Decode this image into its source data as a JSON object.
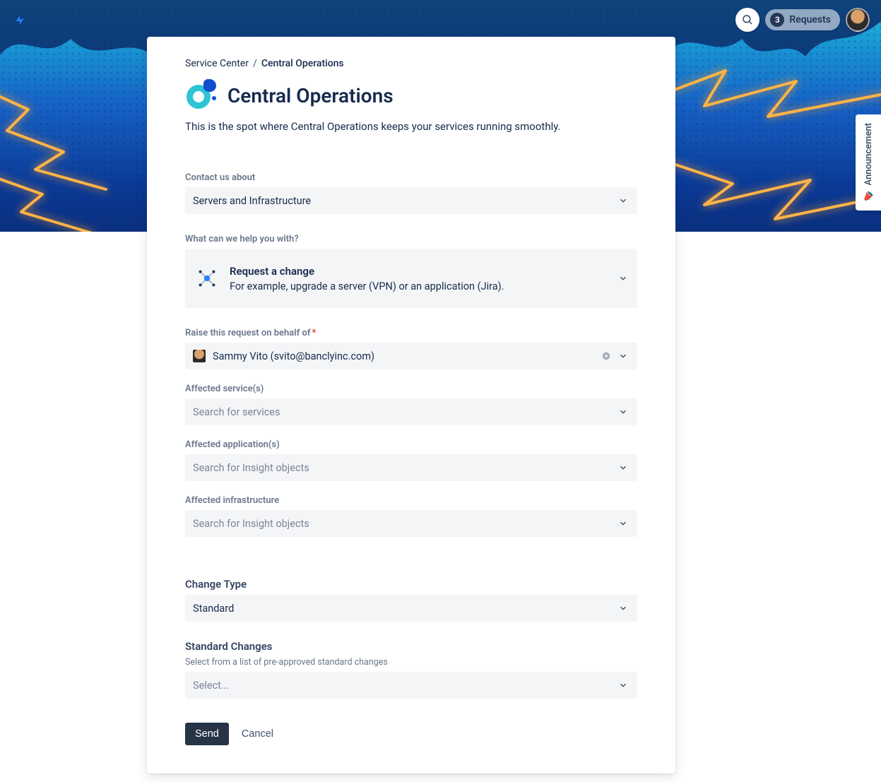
{
  "header": {
    "requests_count": "3",
    "requests_label": "Requests"
  },
  "announce": {
    "label": "Announcement"
  },
  "breadcrumb": {
    "root": "Service Center",
    "sep": "/",
    "current": "Central Operations"
  },
  "page": {
    "title": "Central Operations",
    "description": "This is the spot where Central Operations keeps your services running smoothly."
  },
  "form": {
    "contact_label": "Contact us about",
    "contact_value": "Servers and Infrastructure",
    "help_label": "What can we help you with?",
    "request_type": {
      "title": "Request a change",
      "desc": "For example, upgrade a server (VPN) or an application (Jira)."
    },
    "behalf_label": "Raise this request on behalf of",
    "behalf_value": "Sammy Vito (svito@banclyinc.com)",
    "affected_services_label": "Affected service(s)",
    "affected_services_placeholder": "Search for services",
    "affected_apps_label": "Affected application(s)",
    "affected_apps_placeholder": "Search for Insight objects",
    "affected_infra_label": "Affected infrastructure",
    "affected_infra_placeholder": "Search for Insight objects",
    "change_type_label": "Change Type",
    "change_type_value": "Standard",
    "std_changes_label": "Standard Changes",
    "std_changes_sublabel": "Select from a list of pre-approved standard changes",
    "std_changes_placeholder": "Select...",
    "send": "Send",
    "cancel": "Cancel"
  }
}
